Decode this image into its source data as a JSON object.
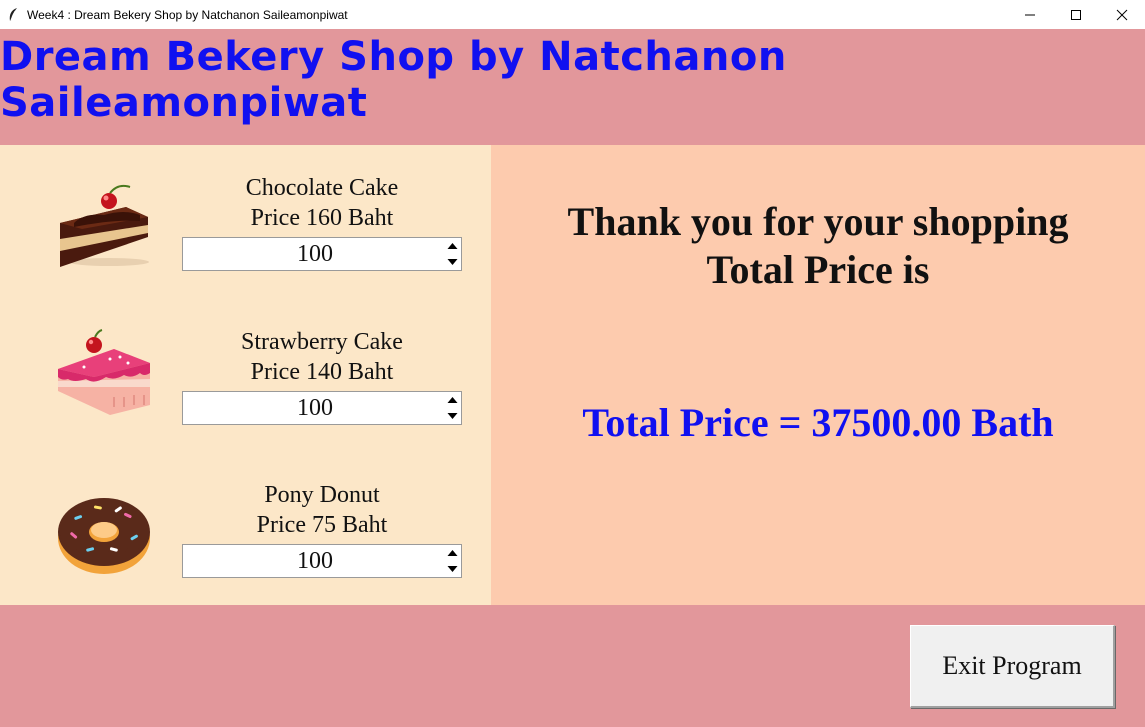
{
  "window": {
    "title": "Week4 : Dream Bekery Shop by Natchanon Saileamonpiwat",
    "icon": "feather-icon"
  },
  "header": {
    "title": "Dream Bekery Shop by Natchanon Saileamonpiwat"
  },
  "products": [
    {
      "name": "Chocolate Cake",
      "price": "Price 160 Baht",
      "quantity": "100",
      "icon": "chocolate-cake-icon"
    },
    {
      "name": "Strawberry Cake",
      "price": "Price 140 Baht",
      "quantity": "100",
      "icon": "strawberry-cake-icon"
    },
    {
      "name": "Pony Donut",
      "price": "Price 75 Baht",
      "quantity": "100",
      "icon": "donut-icon"
    }
  ],
  "summary": {
    "thanks_line1": "Thank you for your shopping",
    "thanks_line2": "Total Price is",
    "total": "Total Price = 37500.00 Bath"
  },
  "footer": {
    "exit_label": "Exit Program"
  },
  "colors": {
    "band": "#e2979b",
    "left_panel": "#fce7c8",
    "right_panel": "#fdcbae",
    "title_blue": "#1010f0"
  }
}
